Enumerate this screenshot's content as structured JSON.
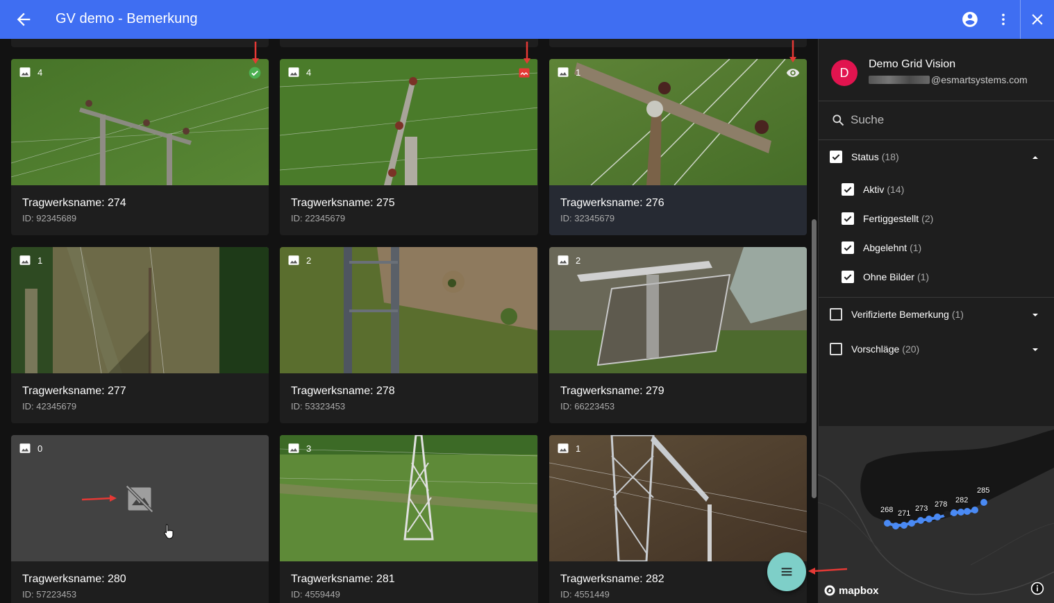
{
  "topbar": {
    "title": "GV demo - Bemerkung",
    "icons": [
      "arrow-back-icon",
      "account-circle-icon",
      "more-vert-icon",
      "close-icon"
    ]
  },
  "cards": [
    {
      "count": "4",
      "name": "Tragwerksname: 274",
      "id": "ID: 92345689",
      "status": "verified-check-icon"
    },
    {
      "count": "4",
      "name": "Tragwerksname: 275",
      "id": "ID: 22345679",
      "status": "rejected-image-icon"
    },
    {
      "count": "1",
      "name": "Tragwerksname: 276",
      "id": "ID: 32345679",
      "status": "eye-icon"
    },
    {
      "count": "1",
      "name": "Tragwerksname: 277",
      "id": "ID: 42345679"
    },
    {
      "count": "2",
      "name": "Tragwerksname: 278",
      "id": "ID: 53323453"
    },
    {
      "count": "2",
      "name": "Tragwerksname: 279",
      "id": "ID: 66223453"
    },
    {
      "count": "0",
      "name": "Tragwerksname: 280",
      "id": "ID: 57223453"
    },
    {
      "count": "3",
      "name": "Tragwerksname: 281",
      "id": "ID: 4559449"
    },
    {
      "count": "1",
      "name": "Tragwerksname: 282",
      "id": "ID: 4551449"
    }
  ],
  "user": {
    "initial": "D",
    "name": "Demo Grid Vision",
    "email_domain": "@esmartsystems.com"
  },
  "search": {
    "placeholder": "Suche"
  },
  "filters": {
    "status": {
      "label": "Status",
      "count": "(18)",
      "checked": true,
      "expanded": true
    },
    "aktiv": {
      "label": "Aktiv",
      "count": "(14)",
      "checked": true
    },
    "fertig": {
      "label": "Fertiggestellt",
      "count": "(2)",
      "checked": true
    },
    "abgelehnt": {
      "label": "Abgelehnt",
      "count": "(1)",
      "checked": true
    },
    "ohne": {
      "label": "Ohne Bilder",
      "count": "(1)",
      "checked": true
    },
    "verifiziert": {
      "label": "Verifizierte Bemerkung",
      "count": "(1)",
      "checked": false,
      "expanded": false
    },
    "vorschlaege": {
      "label": "Vorschläge",
      "count": "(20)",
      "checked": false,
      "expanded": false
    }
  },
  "map": {
    "labels": [
      "268",
      "271",
      "273",
      "278",
      "282",
      "285"
    ],
    "attribution": "mapbox",
    "marker_color": "#4a8af4"
  },
  "colors": {
    "appbar": "#3f6ef2",
    "fab": "#7ecfc8",
    "avatar": "#e1144f",
    "verified": "#4caf50",
    "rejected": "#e53935",
    "annotation_arrow": "#e53935"
  }
}
